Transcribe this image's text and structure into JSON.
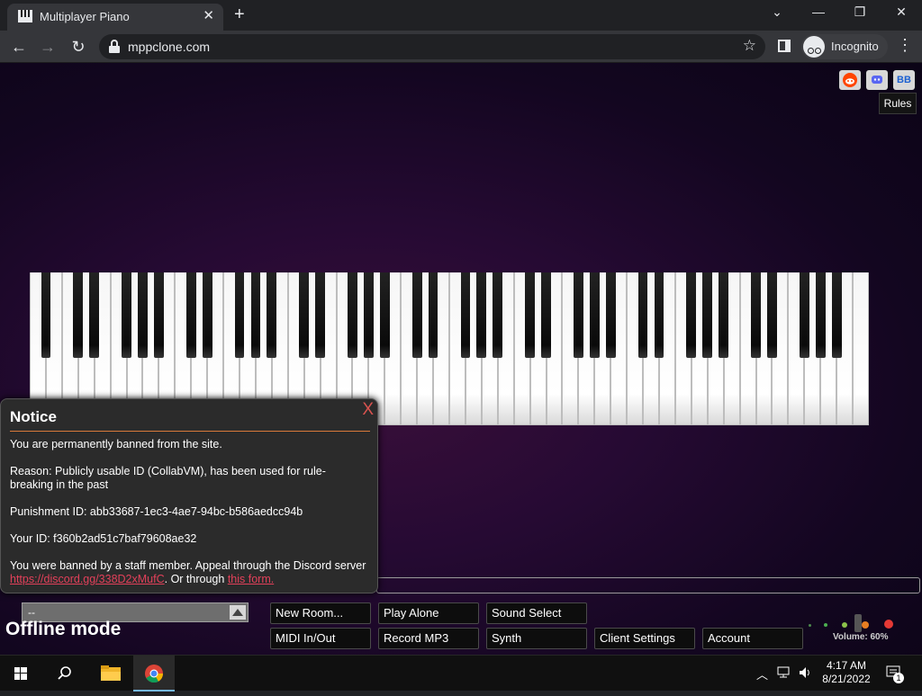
{
  "browser": {
    "tab_title": "Multiplayer Piano",
    "tab_close": "✕",
    "new_tab": "+",
    "url": "mppclone.com",
    "profile_label": "Incognito",
    "window_controls": {
      "tab_search": "⌄",
      "minimize": "—",
      "restore": "❐",
      "close": "✕"
    }
  },
  "page": {
    "social_links": [
      "reddit-icon",
      "discord-icon",
      "bb-icon"
    ],
    "social_bb_text": "BB",
    "rules_label": "Rules",
    "piano": {
      "white_keys": 52,
      "black_keys": 36
    },
    "notice": {
      "close_label": "X",
      "title": "Notice",
      "ban_message": "You are permanently banned from the site.",
      "reason_text": "Reason: Publicly usable ID (CollabVM), has been used for rule-breaking in the past",
      "punishment_id_text": "Punishment ID: abb33687-1ec3-4ae7-94bc-b586aedcc94b",
      "your_id_text": "Your ID: f360b2ad51c7baf79608ae32",
      "appeal_prefix": "You were banned by a staff member. Appeal through the Discord server ",
      "appeal_link": "https://discord.gg/338D2xMufC",
      "appeal_middle": ". Or through ",
      "form_link": "this form."
    },
    "room_select_value": "--",
    "offline_label": "Offline mode",
    "buttons": {
      "new_room": "New Room...",
      "play_alone": "Play Alone",
      "sound_select": "Sound Select",
      "midi": "MIDI In/Out",
      "record_mp3": "Record MP3",
      "synth": "Synth",
      "client_settings": "Client Settings",
      "account": "Account"
    },
    "volume_label": "Volume: 60%",
    "volume_percent": 60
  },
  "taskbar": {
    "time": "4:17 AM",
    "date": "8/21/2022",
    "notification_count": "1",
    "icons": [
      "windows-start-icon",
      "search-icon",
      "file-explorer-icon",
      "chrome-icon"
    ]
  },
  "colors": {
    "accent_link": "#e2405a",
    "notice_rule": "#d97a3a",
    "background": "#260a33"
  }
}
